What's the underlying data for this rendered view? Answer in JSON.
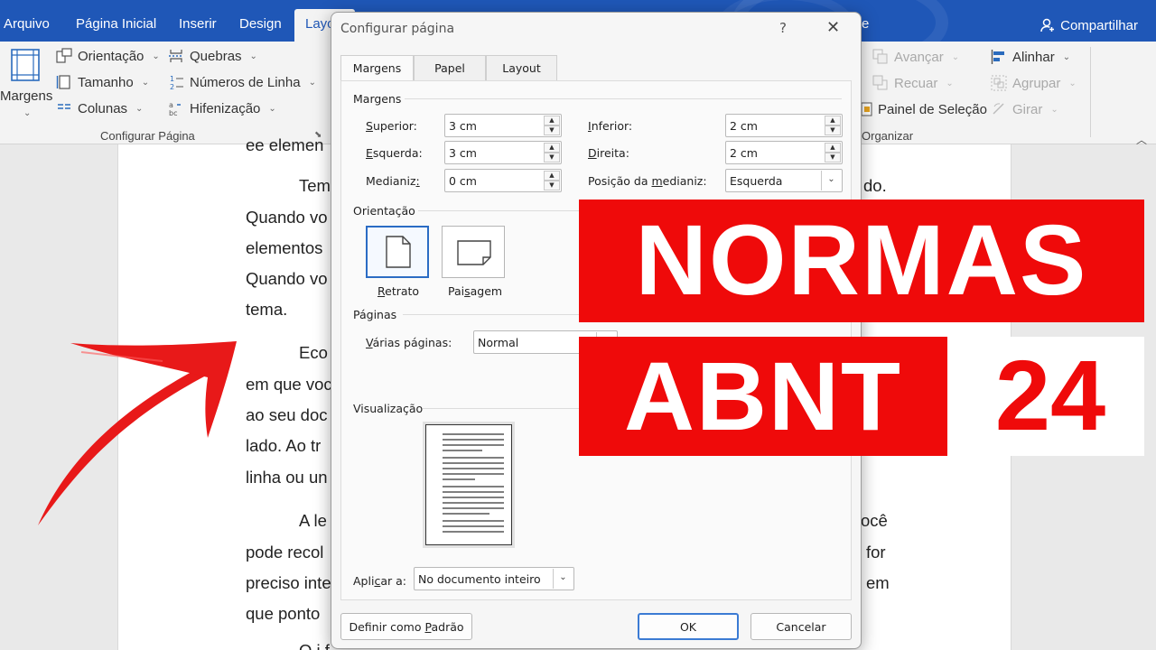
{
  "tabs": [
    "Arquivo",
    "Página Inicial",
    "Inserir",
    "Design",
    "Layout",
    "e"
  ],
  "active_tab": "Layout",
  "share_label": "Compartilhar",
  "ribbon": {
    "margins_label": "Margens",
    "orientation": "Orientação",
    "size": "Tamanho",
    "columns": "Colunas",
    "breaks": "Quebras",
    "line_numbers": "Números de Linha",
    "hyphenation": "Hifenização",
    "group_page_setup": "Configurar Página",
    "bring_forward": "Avançar",
    "send_backward": "Recuar",
    "selection_pane": "Painel de Seleção",
    "align": "Alinhar",
    "group": "Agrupar",
    "rotate": "Girar",
    "group_arrange": "Organizar"
  },
  "document": {
    "lines": [
      "ee elemen",
      "Tem",
      "do.",
      "Quando vo",
      "elementos",
      "Quando vo",
      "tema.",
      "Eco",
      "em que voc",
      "ao seu doc",
      "lado. Ao tr",
      "linha ou un",
      "A le",
      "ocê",
      "pode recol",
      "for",
      "preciso inte",
      "em",
      "que ponto",
      "O   i   f"
    ]
  },
  "dialog": {
    "title": "Configurar página",
    "help": "?",
    "close": "✕",
    "tabs": [
      "Margens",
      "Papel",
      "Layout"
    ],
    "margins_section": "Margens",
    "top_label": "Superior:",
    "top_value": "3 cm",
    "bottom_label": "Inferior:",
    "bottom_value": "2 cm",
    "left_label": "Esquerda:",
    "left_value": "3 cm",
    "right_label": "Direita:",
    "right_value": "2 cm",
    "gutter_label": "Medianiz:",
    "gutter_value": "0 cm",
    "gutter_pos_label": "Posição da medianiz:",
    "gutter_pos_value": "Esquerda",
    "orientation_section": "Orientação",
    "portrait": "Retrato",
    "landscape": "Paisagem",
    "pages_section": "Páginas",
    "multiple_pages_label": "Várias páginas:",
    "multiple_pages_value": "Normal",
    "preview_section": "Visualização",
    "apply_label": "Aplicar a:",
    "apply_value": "No documento inteiro",
    "set_default": "Definir como Padrão",
    "ok": "OK",
    "cancel": "Cancelar"
  },
  "banner": {
    "line1": "NORMAS",
    "line2": "ABNT",
    "year": "24"
  },
  "colors": {
    "word_blue": "#1f57b7",
    "banner_red": "#ef0a0a",
    "arrow_red": "#e81919",
    "selection_blue": "#2b6cc4"
  }
}
